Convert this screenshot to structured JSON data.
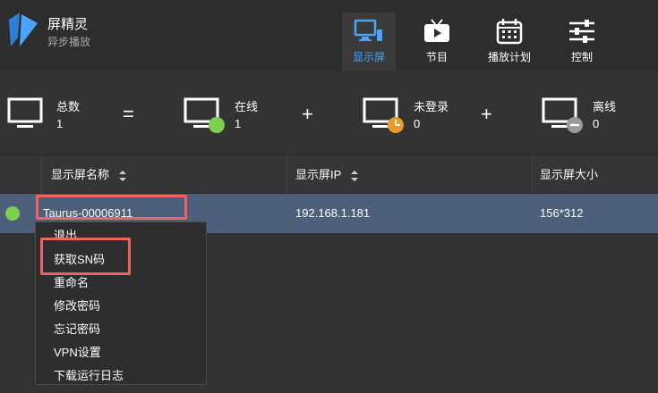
{
  "app": {
    "title": "屏精灵",
    "subtitle": "异步播放"
  },
  "nav": {
    "items": [
      {
        "label": "显示屏",
        "icon": "display-screen-icon",
        "active": true
      },
      {
        "label": "节目",
        "icon": "program-tv-icon",
        "active": false
      },
      {
        "label": "播放计划",
        "icon": "calendar-icon",
        "active": false
      },
      {
        "label": "控制",
        "icon": "sliders-icon",
        "active": false
      }
    ]
  },
  "stats": {
    "total": {
      "label": "总数",
      "count": "1"
    },
    "online": {
      "label": "在线",
      "count": "1"
    },
    "not_logged_in": {
      "label": "未登录",
      "count": "0"
    },
    "offline": {
      "label": "离线",
      "count": "0"
    },
    "equals": "=",
    "plus": "+"
  },
  "table": {
    "headers": [
      "显示屏名称",
      "显示屏IP",
      "显示屏大小"
    ],
    "rows": [
      {
        "name": "Taurus-00006911",
        "ip": "192.168.1.181",
        "size": "156*312",
        "status": "online"
      }
    ]
  },
  "context_menu": {
    "items": [
      "退出",
      "获取SN码",
      "重命名",
      "修改密码",
      "忘记密码",
      "VPN设置",
      "下载运行日志"
    ]
  },
  "colors": {
    "accent": "#4aa3ff",
    "online": "#7cd04d",
    "not_logged_in": "#e89a2c",
    "offline": "#9a9a9a",
    "highlight": "#f06262",
    "selected_row": "#4d5f7a"
  }
}
